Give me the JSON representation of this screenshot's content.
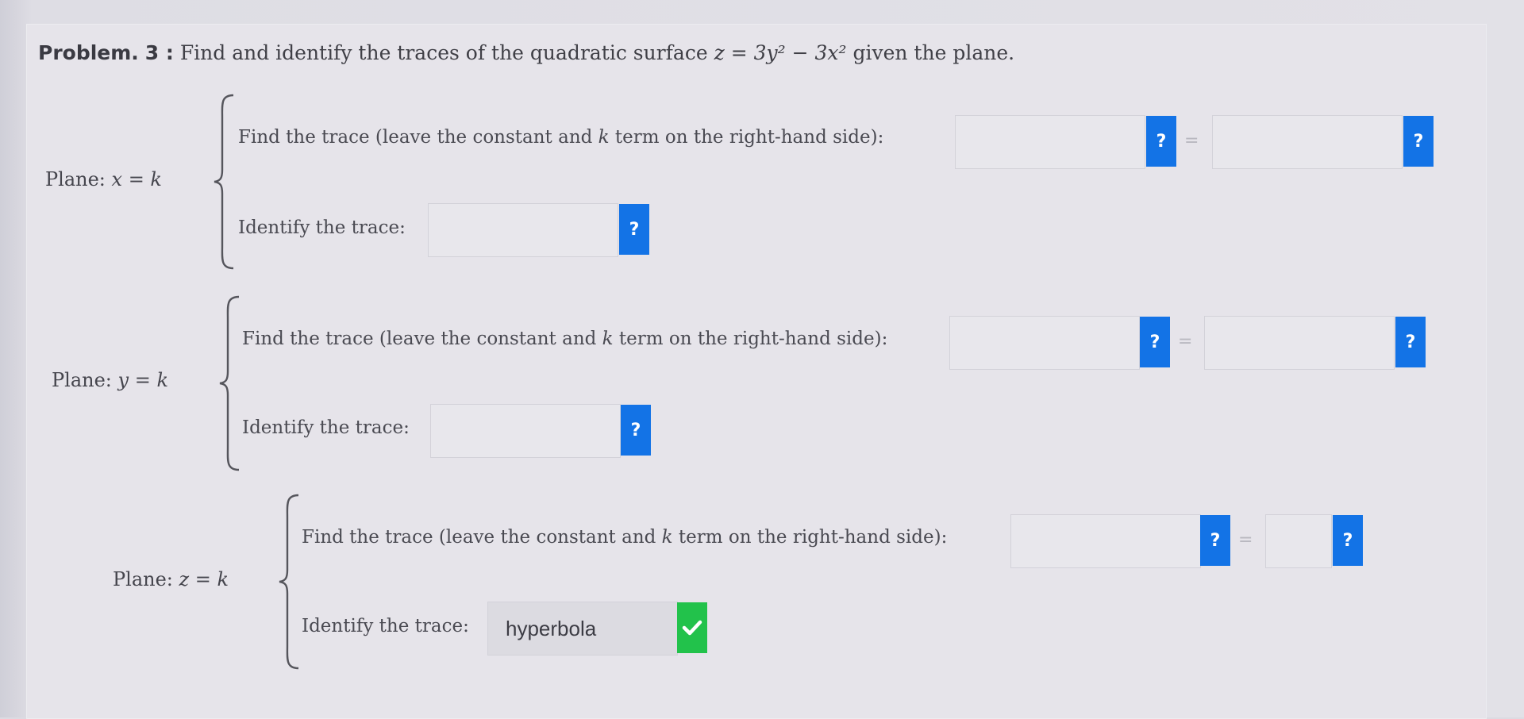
{
  "problem": {
    "label": "Problem.",
    "number_text": "3 :",
    "prefix": "Find and identify the traces of the quadratic surface",
    "equation": "z = 3y² − 3x²",
    "suffix": "given the plane."
  },
  "sections": [
    {
      "plane_label": "Plane:",
      "plane_eq": "x = k",
      "find_text": "Find the trace (leave the constant and",
      "find_k": "k",
      "find_text2": "term on the right-hand side):",
      "identify_text": "Identify the trace:",
      "identify_value": "",
      "left_value": "",
      "right_value": ""
    },
    {
      "plane_label": "Plane:",
      "plane_eq": "y = k",
      "find_text": "Find the trace (leave the constant and",
      "find_k": "k",
      "find_text2": "term on the right-hand side):",
      "identify_text": "Identify the trace:",
      "identify_value": "",
      "left_value": "",
      "right_value": ""
    },
    {
      "plane_label": "Plane:",
      "plane_eq": "z = k",
      "find_text": "Find the trace (leave the constant and",
      "find_k": "k",
      "find_text2": "term on the right-hand side):",
      "identify_text": "Identify the trace:",
      "identify_value": "hyperbola",
      "left_value": "",
      "right_value": ""
    }
  ],
  "help_button_label": "?",
  "equals_sign": "=",
  "icons": {
    "help": "question-icon",
    "correct": "checkmark-icon"
  },
  "colors": {
    "help_button": "#1373e6",
    "correct_badge": "#22c24b"
  }
}
